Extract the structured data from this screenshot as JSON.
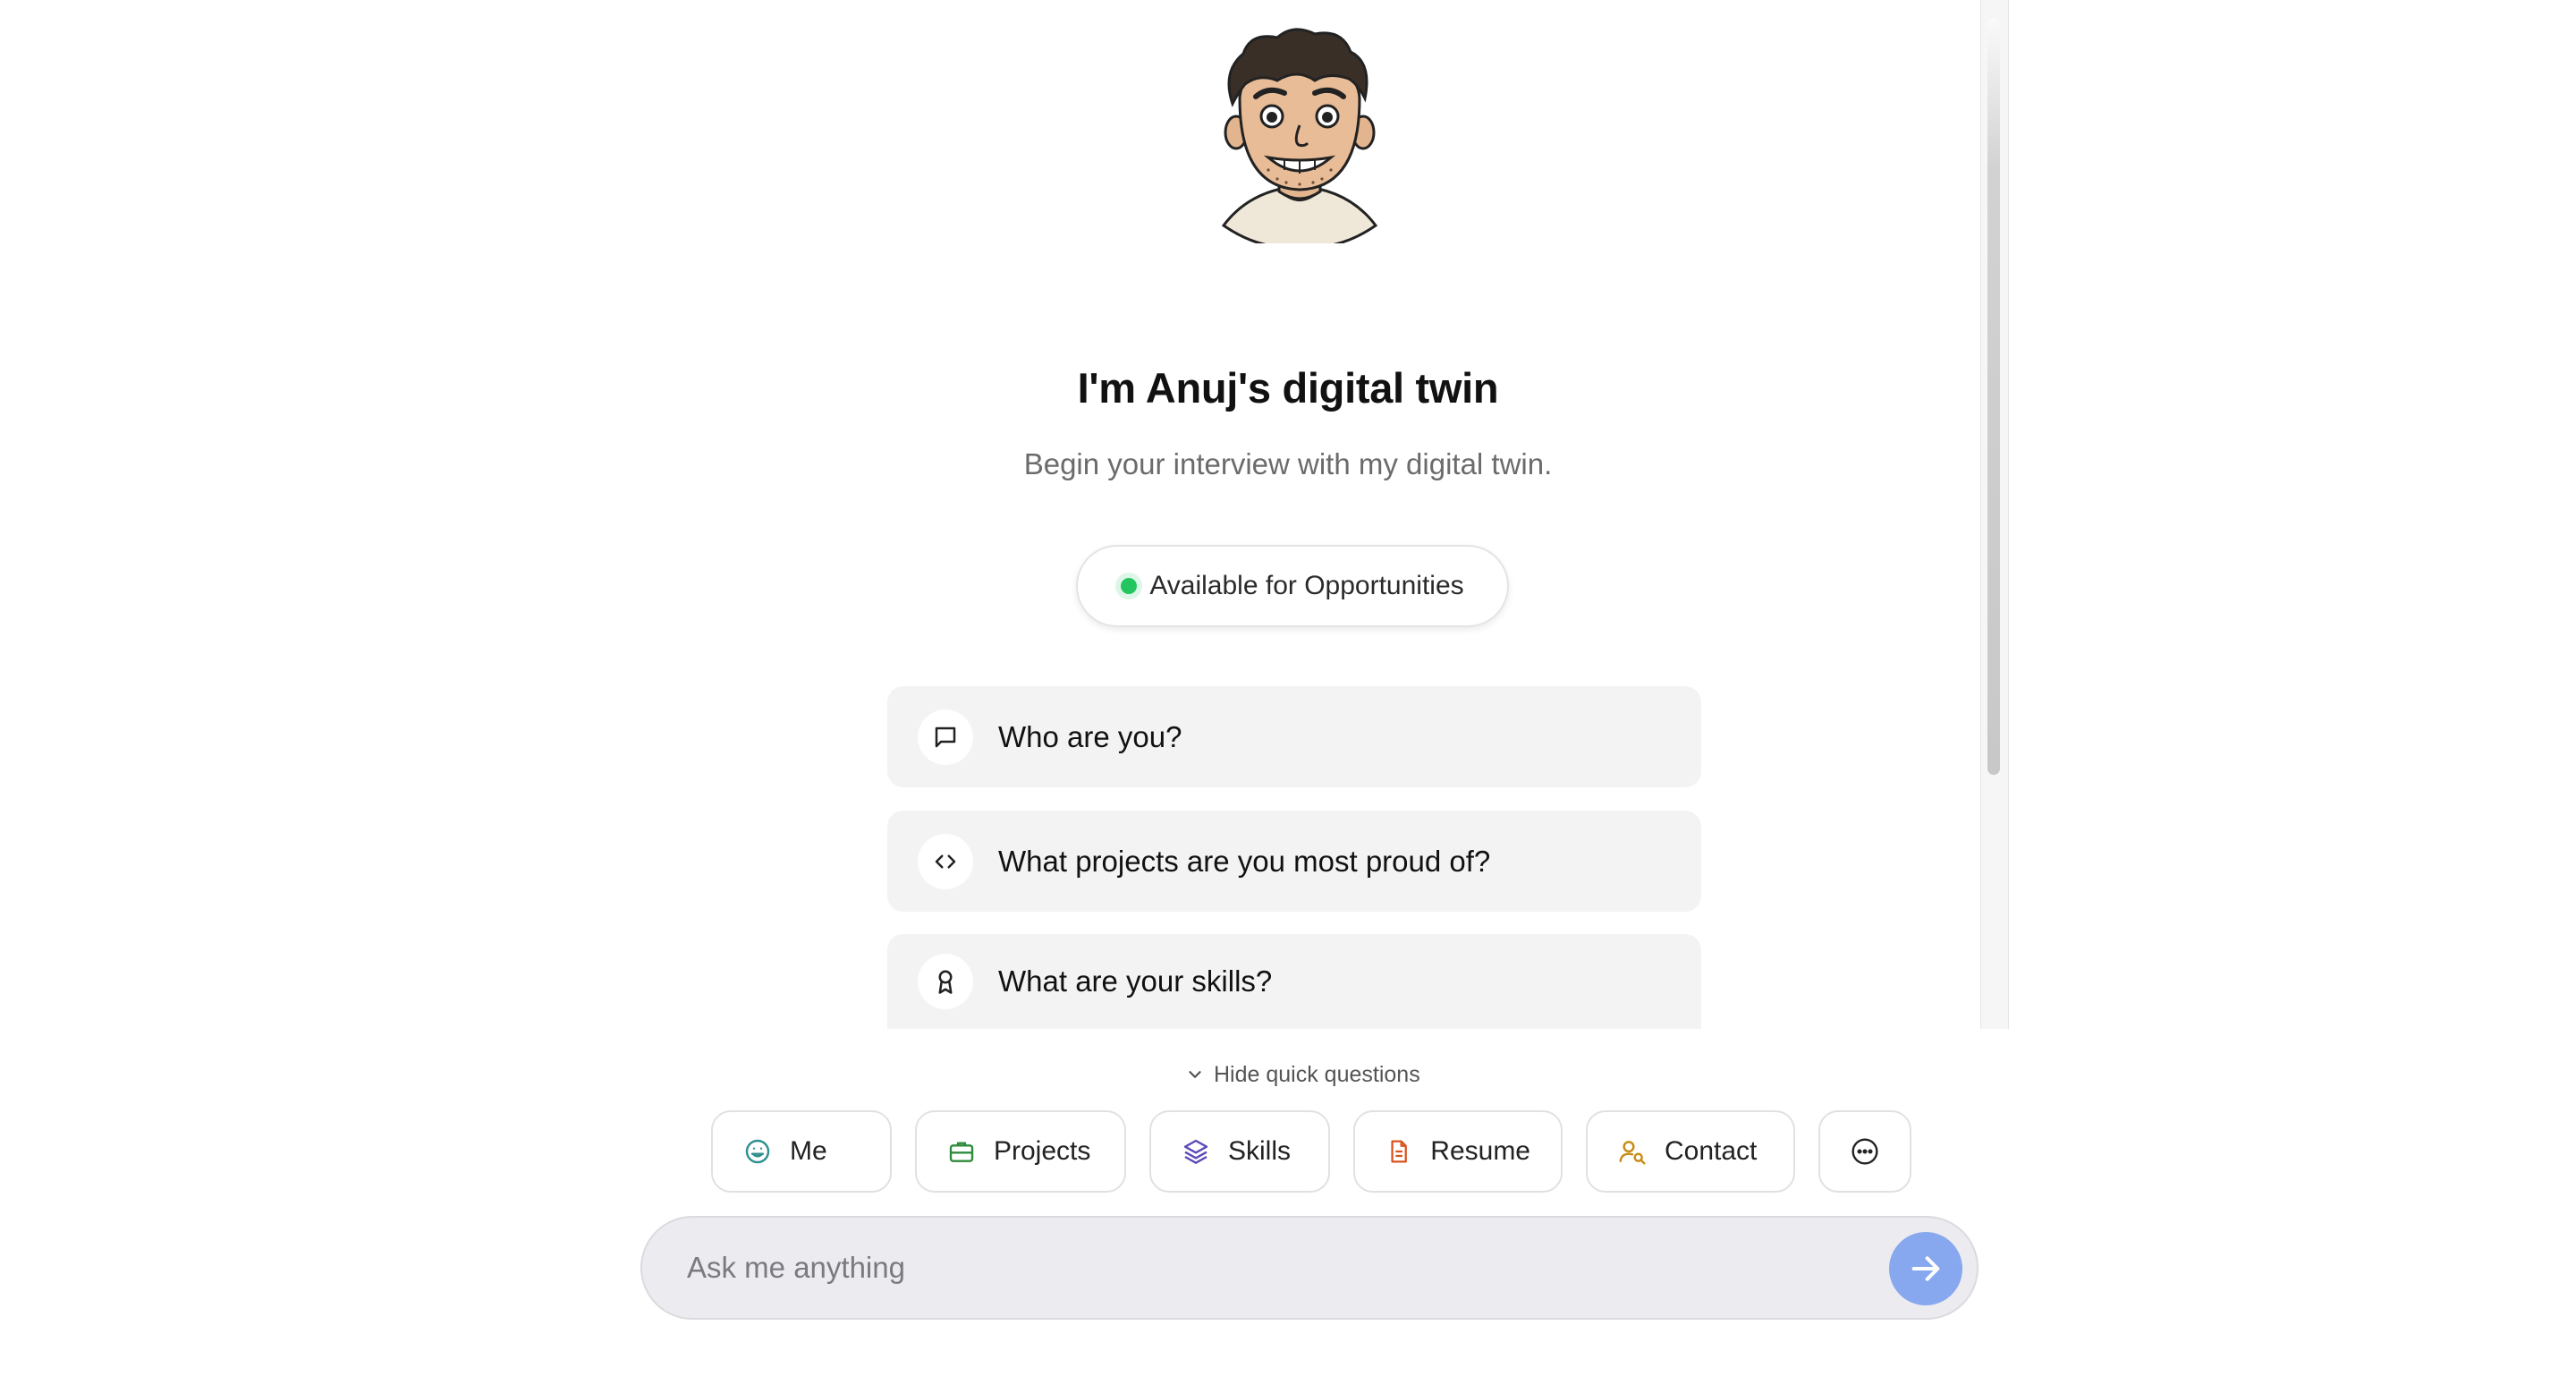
{
  "header": {
    "title": "I'm Anuj's digital twin",
    "subtitle": "Begin your interview with my digital twin.",
    "status": {
      "label": "Available for Opportunities",
      "color": "#22c55e"
    }
  },
  "quick_questions": [
    {
      "label": "Who are you?",
      "icon": "message-square-icon"
    },
    {
      "label": "What projects are you most proud of?",
      "icon": "code-icon"
    },
    {
      "label": "What are your skills?",
      "icon": "award-icon"
    }
  ],
  "toggle": {
    "label": "Hide quick questions"
  },
  "chips": [
    {
      "label": "Me",
      "icon": "smile-icon",
      "color": "#2f8f8f"
    },
    {
      "label": "Projects",
      "icon": "briefcase-icon",
      "color": "#2e8b3c"
    },
    {
      "label": "Skills",
      "icon": "layers-icon",
      "color": "#5b4bb7"
    },
    {
      "label": "Resume",
      "icon": "file-text-icon",
      "color": "#d9541e"
    },
    {
      "label": "Contact",
      "icon": "user-search-icon",
      "color": "#c88a12"
    },
    {
      "label": "",
      "icon": "more-horizontal-icon",
      "color": "#222222"
    }
  ],
  "input": {
    "placeholder": "Ask me anything"
  },
  "colors": {
    "accent": "#87a8ee",
    "card_bg": "#f3f3f3"
  }
}
